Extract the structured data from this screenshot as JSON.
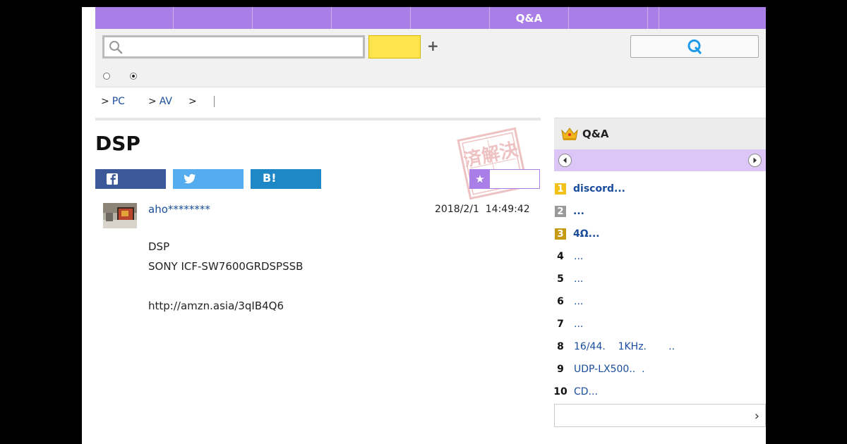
{
  "nav": {
    "items": [
      "",
      "",
      "",
      "",
      "",
      "Q&A",
      "",
      "",
      ""
    ]
  },
  "search": {
    "placeholder": "",
    "value": ""
  },
  "breadcrumb": {
    "items": [
      {
        "prefix": ">",
        "label": "PC"
      },
      {
        "prefix": ">",
        "label": "AV"
      },
      {
        "prefix": ">",
        "label": ""
      }
    ]
  },
  "question": {
    "title": "DSP",
    "stamp_text": "済解決",
    "hatena_label": "B!",
    "fav_icon": "star-icon",
    "username": "aho********",
    "date": "2018/2/1  14:49:42",
    "body": [
      "DSP",
      "SONY ICF-SW7600GRDSPSSB",
      "",
      "http://amzn.asia/3qIB4Q6"
    ]
  },
  "ranking": {
    "title": "Q&A",
    "items": [
      {
        "rank": "1",
        "text": "discord...",
        "style": "gold"
      },
      {
        "rank": "2",
        "text": "...",
        "style": "silver"
      },
      {
        "rank": "3",
        "text": "4Ω...",
        "style": "bronze"
      },
      {
        "rank": "4",
        "text": "...",
        "style": "plain"
      },
      {
        "rank": "5",
        "text": "...",
        "style": "plain"
      },
      {
        "rank": "6",
        "text": "...",
        "style": "plain"
      },
      {
        "rank": "7",
        "text": "...",
        "style": "plain"
      },
      {
        "rank": "8",
        "text": "16/44.    1KHz.       ..",
        "style": "plain"
      },
      {
        "rank": "9",
        "text": "UDP-LX500..  .",
        "style": "plain"
      },
      {
        "rank": "10",
        "text": "CD...",
        "style": "plain"
      }
    ]
  },
  "colors": {
    "accent": "#a97ee6",
    "link": "#1a4d9c",
    "facebook": "#3b5998",
    "twitter": "#55acee",
    "hatena": "#1e88c7",
    "search_button": "#ffe44d"
  }
}
